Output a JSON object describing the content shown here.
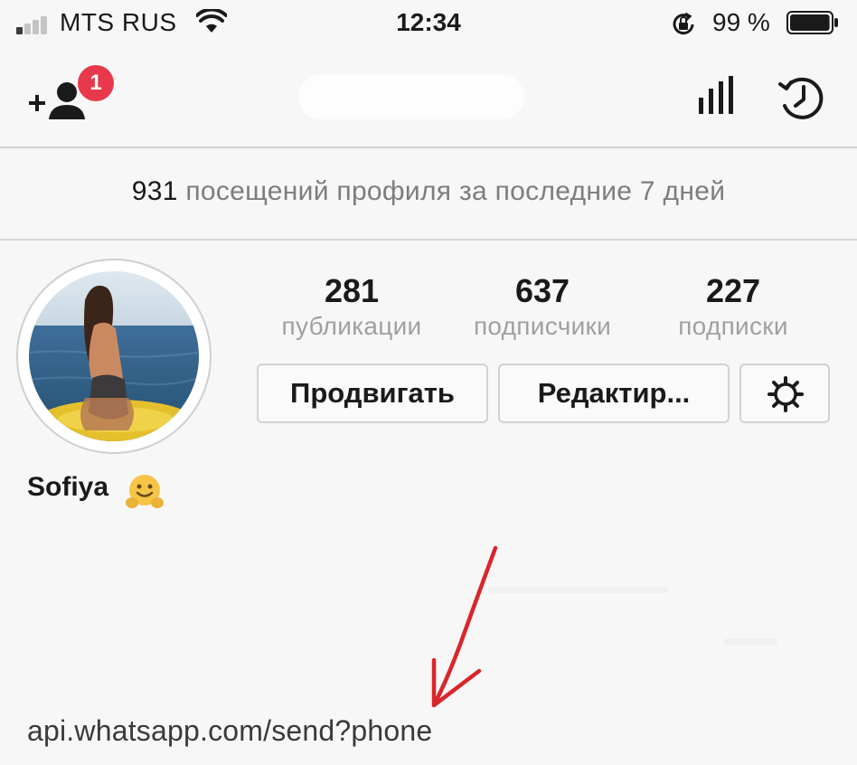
{
  "status_bar": {
    "carrier": "MTS RUS",
    "time": "12:34",
    "battery_percent": "99 %",
    "battery_level": 0.99,
    "signal_bars_filled": 1,
    "icons": [
      "signal-icon",
      "wifi-icon",
      "rotation-lock-icon",
      "battery-icon"
    ]
  },
  "nav_bar": {
    "follow_badge_count": "1",
    "icons": [
      "add-person-icon",
      "insights-icon",
      "history-icon"
    ]
  },
  "visits": {
    "count": "931",
    "text": " посещений профиля за последние 7 дней"
  },
  "profile": {
    "stats": [
      {
        "value": "281",
        "label": "публикации"
      },
      {
        "value": "637",
        "label": "подписчики"
      },
      {
        "value": "227",
        "label": "подписки"
      }
    ],
    "buttons": {
      "promote": "Продвигать",
      "edit": "Редактир..."
    },
    "name": "Sofiya",
    "name_emoji": "hugging-face-emoji",
    "website": "api.whatsapp.com/send?phone"
  },
  "colors": {
    "background": "#f7f7f7",
    "badge": "#e8394c",
    "secondary_text": "#a0a0a0",
    "annotation_arrow": "#d9262a"
  }
}
